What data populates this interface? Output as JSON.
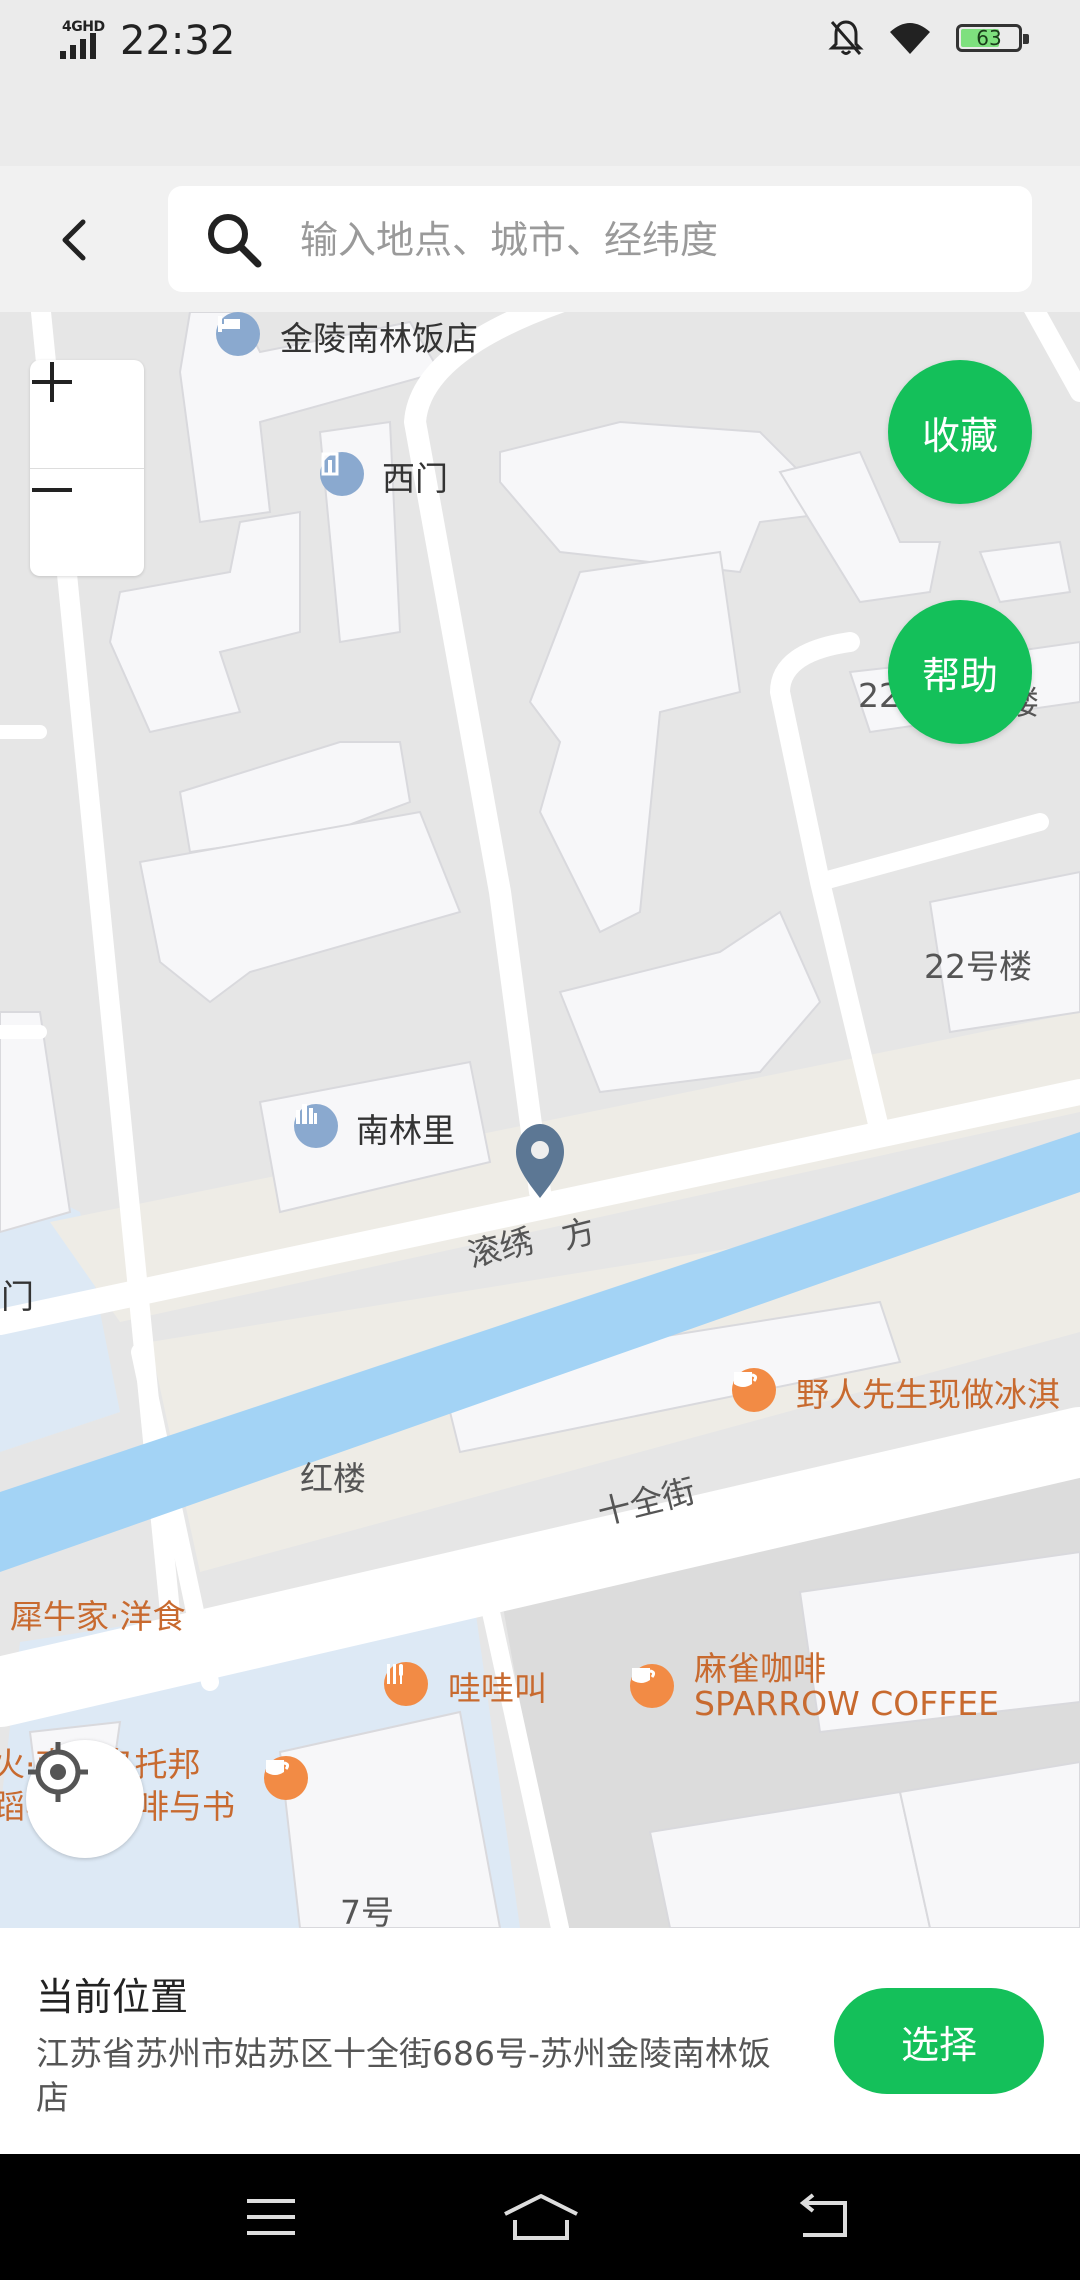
{
  "status_bar": {
    "network": "4GHD",
    "time": "22:32",
    "battery": "63",
    "icons": [
      "signal-icon",
      "mute-bell-icon",
      "wifi-icon",
      "battery-icon"
    ]
  },
  "header": {
    "back_icon": "chevron-left-icon",
    "search_icon": "search-icon",
    "search_placeholder": "输入地点、城市、经纬度",
    "search_value": ""
  },
  "map": {
    "zoom_in": "+",
    "zoom_out": "−",
    "favorite_label": "收藏",
    "help_label": "帮助",
    "locate_icon": "crosshair-icon",
    "labels": {
      "hotel": "金陵南林饭店",
      "west_gate": "西门",
      "building22_partial": "22",
      "building22_partial_tail": "楼",
      "building22": "22号楼",
      "nanlinli": "南林里",
      "road_partial": "滚绣",
      "road_partial_tail": "方",
      "gate_partial": "南门",
      "ice_cream": "野人先生现做冰淇",
      "honglou": "红楼",
      "shiquanjie": "十全街",
      "rhino_cafe": "犀牛家·洋食",
      "wawajiao": "哇哇叫",
      "sparrow_cn": "麻雀咖啡",
      "sparrow_en": "SPARROW COFFEE",
      "utopia_line1": "火·南缶乌托邦",
      "utopia_line2": "啡与书",
      "utopia_line2_pre": "蹈与",
      "no7": "7号"
    }
  },
  "panel": {
    "title": "当前位置",
    "address": "江苏省苏州市姑苏区十全街686号-苏州金陵南林饭店",
    "select_label": "选择"
  },
  "nav_bar": {
    "menu_icon": "menu-icon",
    "home_icon": "home-icon",
    "back_icon": "back-arrow-icon"
  },
  "colors": {
    "accent": "#14c05a",
    "water": "#a3d3f5",
    "poi_orange": "#f28b45",
    "poi_blue": "#8aa9cf"
  }
}
